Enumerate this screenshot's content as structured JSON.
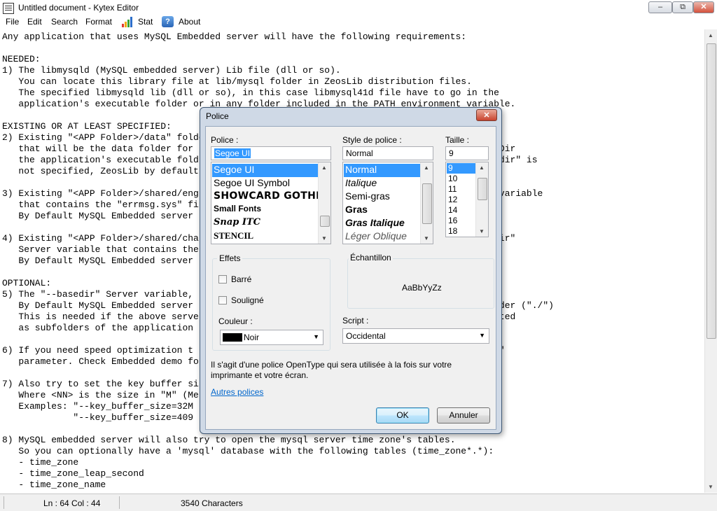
{
  "window": {
    "title": "Untitled document - Kytex Editor",
    "minimize": "–",
    "maximize": "⧉",
    "close": "✕"
  },
  "menu": {
    "file": "File",
    "edit": "Edit",
    "search": "Search",
    "format": "Format",
    "stat": "Stat",
    "about": "About",
    "about_icon_glyph": "?"
  },
  "editor": {
    "lines": [
      "Any application that uses MySQL Embedded server will have the following requirements:",
      "",
      "NEEDED:",
      "1) The libmysqld (MySQL embedded server) Lib file (dll or so).",
      "   You can locate this library file at lib/mysql folder in ZeosLib distribution files.",
      "   The specified libmysqld lib (dll or so), in this case libmysql41d file have to go in the",
      "   application's executable folder or in any folder included in the PATH environment variable.",
      "",
      "EXISTING OR AT LEAST SPECIFIED:",
      "2) Existing \"<APP Folder>/data\" folder                                                    e",
      "   that will be the data folder for                                                    DataDir",
      "   the application's executable fold                                                   datadir\" is",
      "   not specified, ZeosLib by default",
      "",
      "3) Existing \"<APP Folder>/shared/eng                                                   ver variable",
      "   that contains the \"errmsg.sys\" fi",
      "   By Default MySQL Embedded server                                                    '",
      "",
      "4) Existing \"<APP Folder>/shared/cha                                                   ts-dir\"",
      "   Server variable that contains the",
      "   By Default MySQL Embedded server                                                    '.",
      "",
      "OPTIONAL:",
      "5) The \"--basedir\" Server variable,",
      "   By Default MySQL Embedded server                                                     folder (\"./\")",
      "   This is needed if the above serve                                                   located",
      "   as subfolders of the application",
      "",
      "6) If you need speed optimization t                                                    nodb\"",
      "   parameter. Check Embedded demo fo",
      "",
      "7) Also try to set the key buffer si                                                   |K\",",
      "   Where <NN> is the size in \"M\" (Me",
      "   Examples: \"--key_buffer_size=32M",
      "             \"--key_buffer_size=409",
      "",
      "8) MySQL embedded server will also try to open the mysql server time zone's tables.",
      "   So you can optionally have a 'mysql' database with the following tables (time_zone*.*):",
      "   - time_zone",
      "   - time_zone_leap_second",
      "   - time_zone_name"
    ]
  },
  "statusbar": {
    "position": "Ln : 64 Col : 44",
    "characters": "3540 Characters"
  },
  "dialog": {
    "title": "Police",
    "close": "✕",
    "font_label": "Police :",
    "font_value": "Segoe UI",
    "font_list": [
      "Segoe UI",
      "Segoe UI Symbol",
      "SHOWCARD GOTHIC",
      "Small Fonts",
      "Snap ITC",
      "STENCIL"
    ],
    "style_label": "Style de police :",
    "style_value": "Normal",
    "style_list": [
      "Normal",
      "Italique",
      "Semi-gras",
      "Gras",
      "Gras Italique",
      "Léger Oblique"
    ],
    "size_label": "Taille :",
    "size_value": "9",
    "size_list": [
      "9",
      "10",
      "11",
      "12",
      "14",
      "16",
      "18"
    ],
    "effects_label": "Effets",
    "strikeout_label": "Barré",
    "underline_label": "Souligné",
    "color_label": "Couleur :",
    "color_value": "Noir",
    "color_hex": "#000000",
    "sample_label": "Échantillon",
    "sample_text": "AaBbYyZz",
    "script_label": "Script :",
    "script_value": "Occidental",
    "description": "Il s'agit d'une police OpenType qui sera utilisée à la fois sur votre imprimante et votre écran.",
    "description_line1": "Il s'agit d'une police OpenType qui sera utilisée à la fois sur votre",
    "description_line2": "imprimante et votre écran.",
    "more_fonts_link": "Autres polices",
    "ok_label": "OK",
    "cancel_label": "Annuler"
  },
  "colors": {
    "selection": "#3399ff",
    "link": "#0066cc",
    "dialog_frame": "#cfd9e6"
  }
}
